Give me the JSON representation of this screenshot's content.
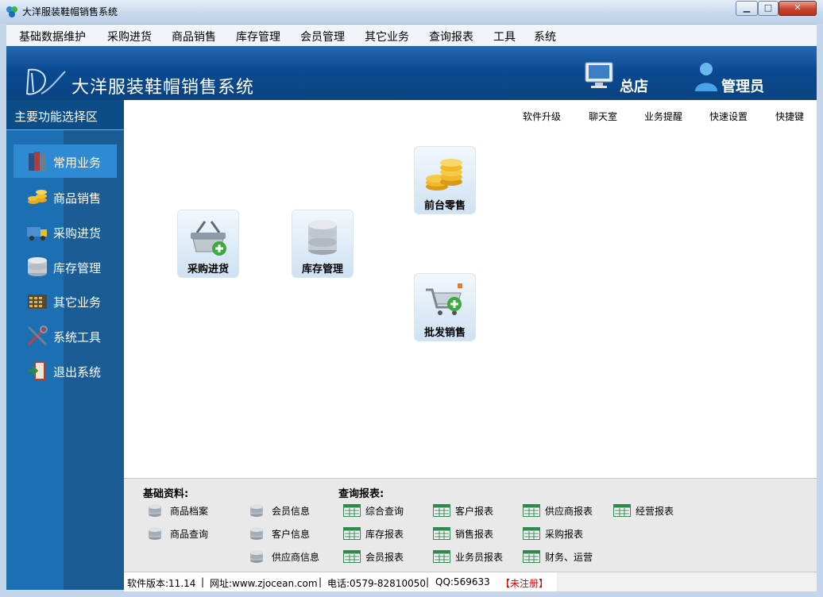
{
  "window": {
    "title": "大洋服装鞋帽销售系统",
    "min_label": "▁",
    "max_label": "□",
    "close_label": "✕"
  },
  "menu": [
    "基础数据维护",
    "采购进货",
    "商品销售",
    "库存管理",
    "会员管理",
    "其它业务",
    "查询报表",
    "工具",
    "系统"
  ],
  "banner": {
    "title": "大洋服装鞋帽销售系统",
    "store": "总店",
    "user": "管理员"
  },
  "sidebar": {
    "title": "主要功能选择区",
    "items": [
      {
        "label": "常用业务",
        "icon": "books-icon"
      },
      {
        "label": "商品销售",
        "icon": "coins-icon"
      },
      {
        "label": "采购进货",
        "icon": "truck-icon"
      },
      {
        "label": "库存管理",
        "icon": "database-icon"
      },
      {
        "label": "其它业务",
        "icon": "calendar-icon"
      },
      {
        "label": "系统工具",
        "icon": "tools-icon"
      },
      {
        "label": "退出系统",
        "icon": "exit-icon"
      }
    ]
  },
  "toplinks": [
    "软件升级",
    "聊天室",
    "业务提醒",
    "快速设置",
    "快捷键"
  ],
  "tiles": [
    {
      "label": "前台零售",
      "icon": "coins-stack-icon"
    },
    {
      "label": "采购进货",
      "icon": "basket-add-icon"
    },
    {
      "label": "库存管理",
      "icon": "database-icon"
    },
    {
      "label": "批发销售",
      "icon": "cart-add-icon"
    }
  ],
  "bottom": {
    "basic_title": "基础资料:",
    "report_title": "查询报表:",
    "basic_links": [
      "商品档案",
      "商品查询",
      "会员信息",
      "客户信息",
      "供应商信息"
    ],
    "report_links": [
      "综合查询",
      "库存报表",
      "会员报表",
      "客户报表",
      "销售报表",
      "业务员报表",
      "供应商报表",
      "采购报表",
      "财务、运营",
      "经营报表"
    ]
  },
  "status": {
    "version": "软件版本:11.14",
    "website": "网址:www.zjocean.com",
    "phone": "电话:0579-82810050",
    "qq": "QQ:569633",
    "registration": "【未注册】",
    "sep": "|"
  },
  "colors": {
    "banner": "#0b4f99",
    "sidebar": "#1d6fb3",
    "sidebar_active": "#2e8ad2",
    "unregistered": "#e00000"
  }
}
